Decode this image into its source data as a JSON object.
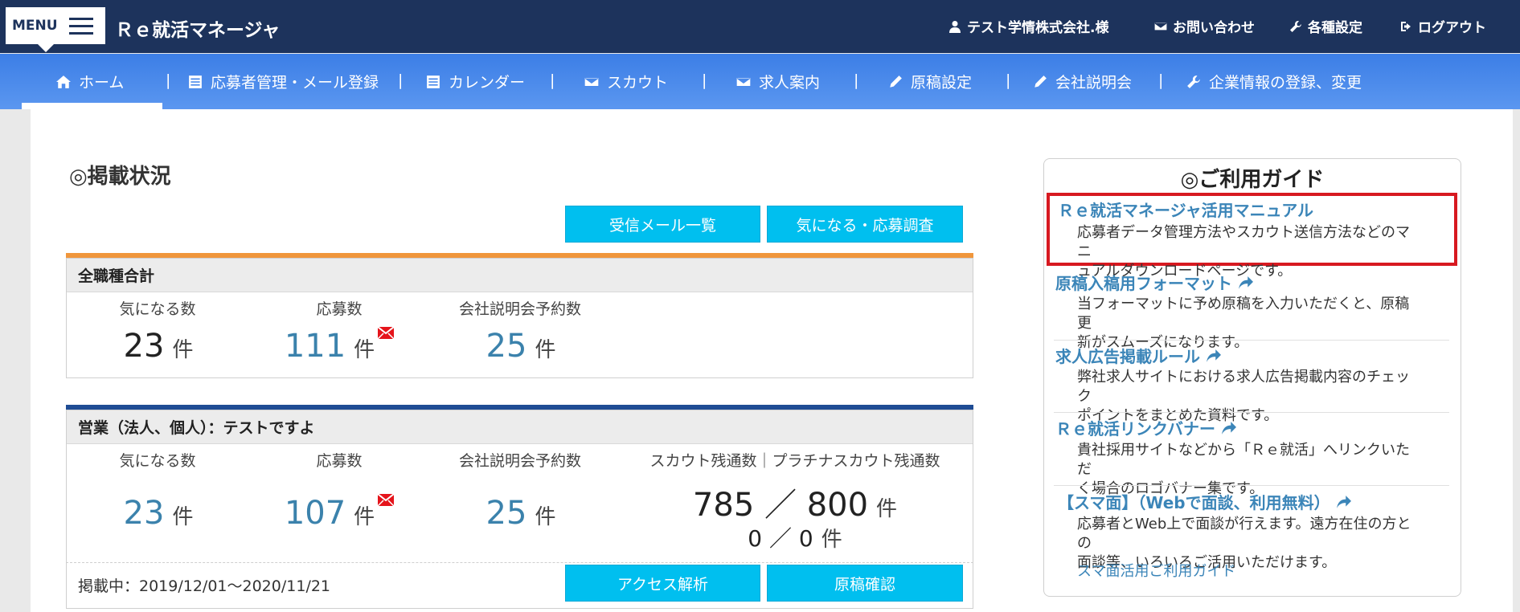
{
  "header": {
    "menu_label": "MENU",
    "app_title": "Ｒｅ就活マネージャ",
    "user_label": "テスト学情株式会社.様",
    "contact_label": "お問い合わせ",
    "settings_label": "各種設定",
    "logout_label": "ログアウト"
  },
  "nav": {
    "items": [
      {
        "label": "ホーム",
        "icon": "home-icon"
      },
      {
        "label": "応募者管理・メール登録",
        "icon": "list-icon"
      },
      {
        "label": "カレンダー",
        "icon": "list-icon"
      },
      {
        "label": "スカウト",
        "icon": "mail-icon"
      },
      {
        "label": "求人案内",
        "icon": "mail-icon"
      },
      {
        "label": "原稿設定",
        "icon": "pencil-icon"
      },
      {
        "label": "会社説明会",
        "icon": "pencil-icon"
      },
      {
        "label": "企業情報の登録、変更",
        "icon": "wrench-icon"
      }
    ],
    "separator": "|"
  },
  "main": {
    "section_title": "◎掲載状況",
    "btn_received_mail": "受信メール一覧",
    "btn_interest_survey": "気になる・応募調査",
    "summary": {
      "title": "全職種合計",
      "label_interest": "気になる数",
      "label_applications": "応募数",
      "label_seminar": "会社説明会予約数",
      "interest": "23",
      "applications": "111",
      "seminar": "25",
      "unit": "件"
    },
    "job": {
      "title": "営業（法人、個人）：テストですよ",
      "label_interest": "気になる数",
      "label_applications": "応募数",
      "label_seminar": "会社説明会予約数",
      "label_scout": "スカウト残通数｜プラチナスカウト残通数",
      "interest": "23",
      "applications": "107",
      "seminar": "25",
      "scout_remaining": "785 ／ 800",
      "platinum_remaining": "0 ／ 0",
      "unit": "件",
      "period": "掲載中：2019/12/01～2020/11/21",
      "btn_access": "アクセス解析",
      "btn_draft": "原稿確認"
    }
  },
  "guide": {
    "title": "◎ご利用ガイド",
    "items": [
      {
        "link": "Ｒｅ就活マネージャ活用マニュアル",
        "desc1": "応募者データ管理方法やスカウト送信方法などのマニ",
        "desc2": "ュアルダウンロードページです。"
      },
      {
        "link": "原稿入稿用フォーマット",
        "desc1": "当フォーマットに予め原稿を入力いただくと、原稿更",
        "desc2": "新がスムーズになります。"
      },
      {
        "link": "求人広告掲載ルール",
        "desc1": "弊社求人サイトにおける求人広告掲載内容のチェック",
        "desc2": "ポイントをまとめた資料です。"
      },
      {
        "link": "Ｒｅ就活リンクバナー",
        "desc1": "貴社採用サイトなどから「Ｒｅ就活」へリンクいただ",
        "desc2": "く場合のロゴバナー集です。"
      },
      {
        "link": "【スマ面】（Webで面談、利用無料）",
        "desc1": "応募者とWeb上で面談が行えます。遠方在住の方との",
        "desc2": "面談等、いろいろご活用いただけます。"
      }
    ],
    "sumamen_guide_link": "スマ面活用ご利用ガイド"
  },
  "colors": {
    "header_bg": "#1d335c",
    "nav_bg": "#3c7ee6",
    "button_bg": "#00bfef",
    "summary_accent": "#f0963c",
    "job_accent": "#1f4c94",
    "highlight_border": "#d71920",
    "link": "#3b85b8"
  }
}
